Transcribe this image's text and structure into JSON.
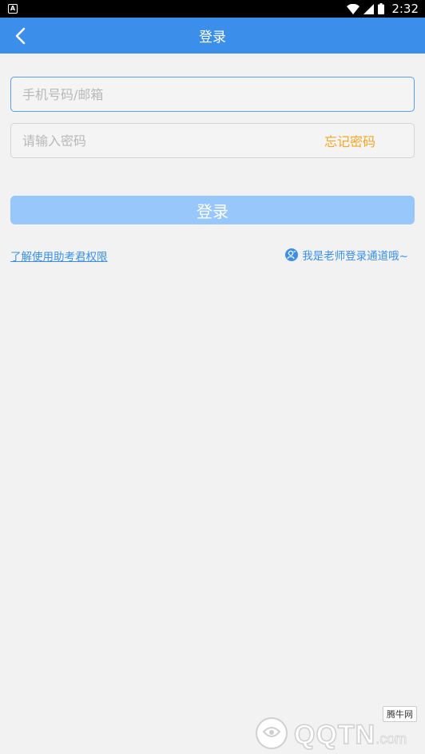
{
  "status_bar": {
    "app_badge": "A",
    "time": "2:32"
  },
  "app_bar": {
    "title": "登录"
  },
  "form": {
    "phone_placeholder": "手机号码/邮箱",
    "password_placeholder": "请输入密码",
    "forgot_label": "忘记密码",
    "login_label": "登录"
  },
  "links": {
    "permission": "了解使用助考君权限",
    "teacher": "我是老师登录通道哦~"
  },
  "watermark": {
    "badge": "腾牛网",
    "brand": "QQTN",
    "suffix": ".com"
  },
  "colors": {
    "primary": "#3b8fea",
    "button_disabled": "#97c7fb",
    "accent": "#f5a623",
    "background": "#f2f2f2"
  }
}
